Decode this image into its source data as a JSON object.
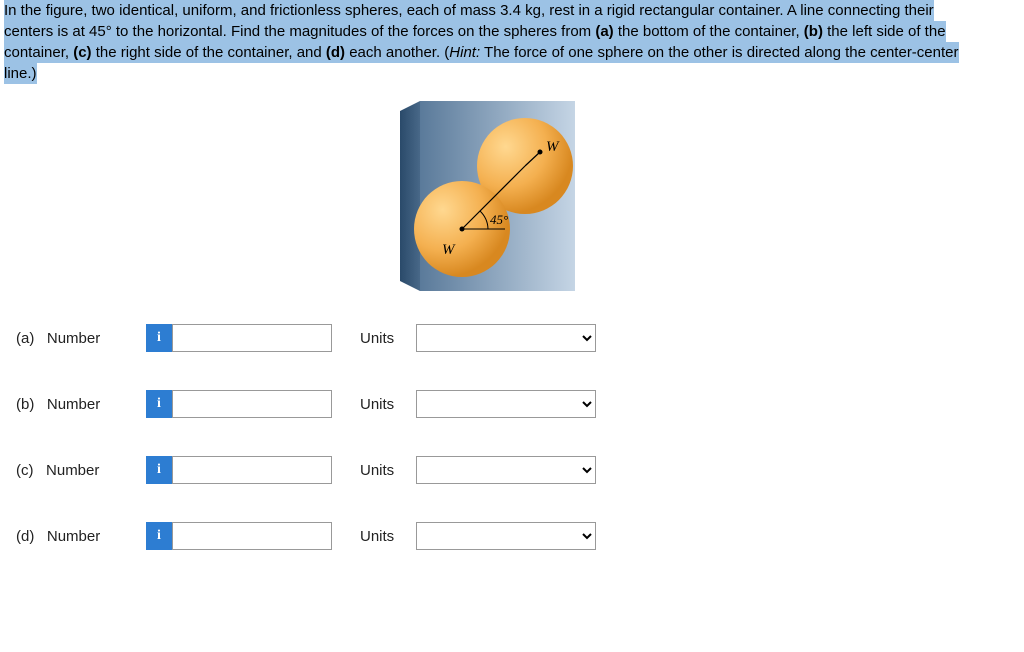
{
  "problem": {
    "text_part1": "In the figure, two identical, uniform, and frictionless spheres, each of mass 3.4 kg, rest in a rigid rectangular container. A line connecting their centers is at 45° to the horizontal. Find the magnitudes of the forces on the spheres from ",
    "bold_a": "(a)",
    "text_a": " the bottom of the container, ",
    "bold_b": "(b)",
    "text_b": " the left side of the container, ",
    "bold_c": "(c)",
    "text_c": " the right side of the container, and ",
    "bold_d": "(d)",
    "text_d": " each another. (",
    "hint_label": "Hint:",
    "hint_text": " The force of one sphere on the other is directed along the center-center line.)"
  },
  "figure": {
    "angle_label": "45°",
    "w1": "W",
    "w2": "W"
  },
  "answers": {
    "rows": [
      {
        "part": "(a)",
        "number_label": "Number",
        "units_label": "Units"
      },
      {
        "part": "(b)",
        "number_label": "Number",
        "units_label": "Units"
      },
      {
        "part": "(c)",
        "number_label": "Number",
        "units_label": "Units"
      },
      {
        "part": "(d)",
        "number_label": "Number",
        "units_label": "Units"
      }
    ],
    "info_icon": "i"
  }
}
